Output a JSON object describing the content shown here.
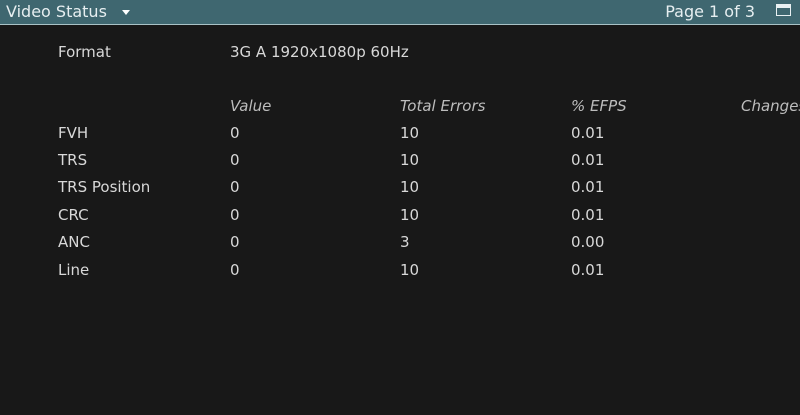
{
  "header": {
    "title": "Video Status",
    "page_indicator": "Page 1 of 3"
  },
  "format": {
    "label": "Format",
    "value": "3G A 1920x1080p 60Hz"
  },
  "table": {
    "columns": [
      "Value",
      "Total Errors",
      "% EFPS",
      "Changes"
    ],
    "rows": [
      {
        "label": "FVH",
        "value": "0",
        "total_errors": "10",
        "efps": "0.01"
      },
      {
        "label": "TRS",
        "value": "0",
        "total_errors": "10",
        "efps": "0.01"
      },
      {
        "label": "TRS Position",
        "value": "0",
        "total_errors": "10",
        "efps": "0.01"
      },
      {
        "label": "CRC",
        "value": "0",
        "total_errors": "10",
        "efps": "0.01"
      },
      {
        "label": "ANC",
        "value": "0",
        "total_errors": "3",
        "efps": "0.00"
      },
      {
        "label": "Line",
        "value": "0",
        "total_errors": "10",
        "efps": "0.01"
      }
    ]
  },
  "icons": {
    "title_dropdown": "chevron-down-icon",
    "maximize": "maximize-icon"
  },
  "colors": {
    "titlebar": "#3f6770",
    "background": "#181818",
    "text": "#d8d8d8"
  }
}
